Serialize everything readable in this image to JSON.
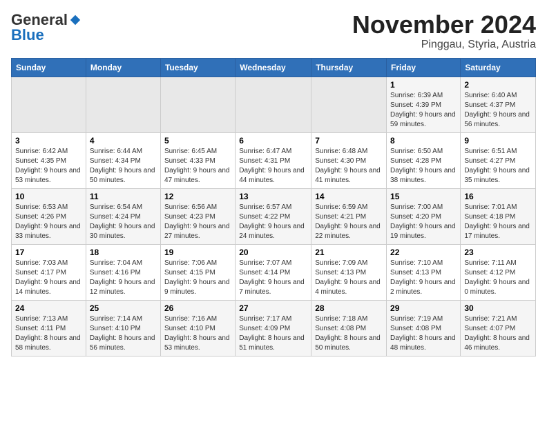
{
  "header": {
    "logo_general": "General",
    "logo_blue": "Blue",
    "month_title": "November 2024",
    "location": "Pinggau, Styria, Austria"
  },
  "weekdays": [
    "Sunday",
    "Monday",
    "Tuesday",
    "Wednesday",
    "Thursday",
    "Friday",
    "Saturday"
  ],
  "weeks": [
    [
      {
        "day": "",
        "info": ""
      },
      {
        "day": "",
        "info": ""
      },
      {
        "day": "",
        "info": ""
      },
      {
        "day": "",
        "info": ""
      },
      {
        "day": "",
        "info": ""
      },
      {
        "day": "1",
        "info": "Sunrise: 6:39 AM\nSunset: 4:39 PM\nDaylight: 9 hours and 59 minutes."
      },
      {
        "day": "2",
        "info": "Sunrise: 6:40 AM\nSunset: 4:37 PM\nDaylight: 9 hours and 56 minutes."
      }
    ],
    [
      {
        "day": "3",
        "info": "Sunrise: 6:42 AM\nSunset: 4:35 PM\nDaylight: 9 hours and 53 minutes."
      },
      {
        "day": "4",
        "info": "Sunrise: 6:44 AM\nSunset: 4:34 PM\nDaylight: 9 hours and 50 minutes."
      },
      {
        "day": "5",
        "info": "Sunrise: 6:45 AM\nSunset: 4:33 PM\nDaylight: 9 hours and 47 minutes."
      },
      {
        "day": "6",
        "info": "Sunrise: 6:47 AM\nSunset: 4:31 PM\nDaylight: 9 hours and 44 minutes."
      },
      {
        "day": "7",
        "info": "Sunrise: 6:48 AM\nSunset: 4:30 PM\nDaylight: 9 hours and 41 minutes."
      },
      {
        "day": "8",
        "info": "Sunrise: 6:50 AM\nSunset: 4:28 PM\nDaylight: 9 hours and 38 minutes."
      },
      {
        "day": "9",
        "info": "Sunrise: 6:51 AM\nSunset: 4:27 PM\nDaylight: 9 hours and 35 minutes."
      }
    ],
    [
      {
        "day": "10",
        "info": "Sunrise: 6:53 AM\nSunset: 4:26 PM\nDaylight: 9 hours and 33 minutes."
      },
      {
        "day": "11",
        "info": "Sunrise: 6:54 AM\nSunset: 4:24 PM\nDaylight: 9 hours and 30 minutes."
      },
      {
        "day": "12",
        "info": "Sunrise: 6:56 AM\nSunset: 4:23 PM\nDaylight: 9 hours and 27 minutes."
      },
      {
        "day": "13",
        "info": "Sunrise: 6:57 AM\nSunset: 4:22 PM\nDaylight: 9 hours and 24 minutes."
      },
      {
        "day": "14",
        "info": "Sunrise: 6:59 AM\nSunset: 4:21 PM\nDaylight: 9 hours and 22 minutes."
      },
      {
        "day": "15",
        "info": "Sunrise: 7:00 AM\nSunset: 4:20 PM\nDaylight: 9 hours and 19 minutes."
      },
      {
        "day": "16",
        "info": "Sunrise: 7:01 AM\nSunset: 4:18 PM\nDaylight: 9 hours and 17 minutes."
      }
    ],
    [
      {
        "day": "17",
        "info": "Sunrise: 7:03 AM\nSunset: 4:17 PM\nDaylight: 9 hours and 14 minutes."
      },
      {
        "day": "18",
        "info": "Sunrise: 7:04 AM\nSunset: 4:16 PM\nDaylight: 9 hours and 12 minutes."
      },
      {
        "day": "19",
        "info": "Sunrise: 7:06 AM\nSunset: 4:15 PM\nDaylight: 9 hours and 9 minutes."
      },
      {
        "day": "20",
        "info": "Sunrise: 7:07 AM\nSunset: 4:14 PM\nDaylight: 9 hours and 7 minutes."
      },
      {
        "day": "21",
        "info": "Sunrise: 7:09 AM\nSunset: 4:13 PM\nDaylight: 9 hours and 4 minutes."
      },
      {
        "day": "22",
        "info": "Sunrise: 7:10 AM\nSunset: 4:13 PM\nDaylight: 9 hours and 2 minutes."
      },
      {
        "day": "23",
        "info": "Sunrise: 7:11 AM\nSunset: 4:12 PM\nDaylight: 9 hours and 0 minutes."
      }
    ],
    [
      {
        "day": "24",
        "info": "Sunrise: 7:13 AM\nSunset: 4:11 PM\nDaylight: 8 hours and 58 minutes."
      },
      {
        "day": "25",
        "info": "Sunrise: 7:14 AM\nSunset: 4:10 PM\nDaylight: 8 hours and 56 minutes."
      },
      {
        "day": "26",
        "info": "Sunrise: 7:16 AM\nSunset: 4:10 PM\nDaylight: 8 hours and 53 minutes."
      },
      {
        "day": "27",
        "info": "Sunrise: 7:17 AM\nSunset: 4:09 PM\nDaylight: 8 hours and 51 minutes."
      },
      {
        "day": "28",
        "info": "Sunrise: 7:18 AM\nSunset: 4:08 PM\nDaylight: 8 hours and 50 minutes."
      },
      {
        "day": "29",
        "info": "Sunrise: 7:19 AM\nSunset: 4:08 PM\nDaylight: 8 hours and 48 minutes."
      },
      {
        "day": "30",
        "info": "Sunrise: 7:21 AM\nSunset: 4:07 PM\nDaylight: 8 hours and 46 minutes."
      }
    ]
  ]
}
